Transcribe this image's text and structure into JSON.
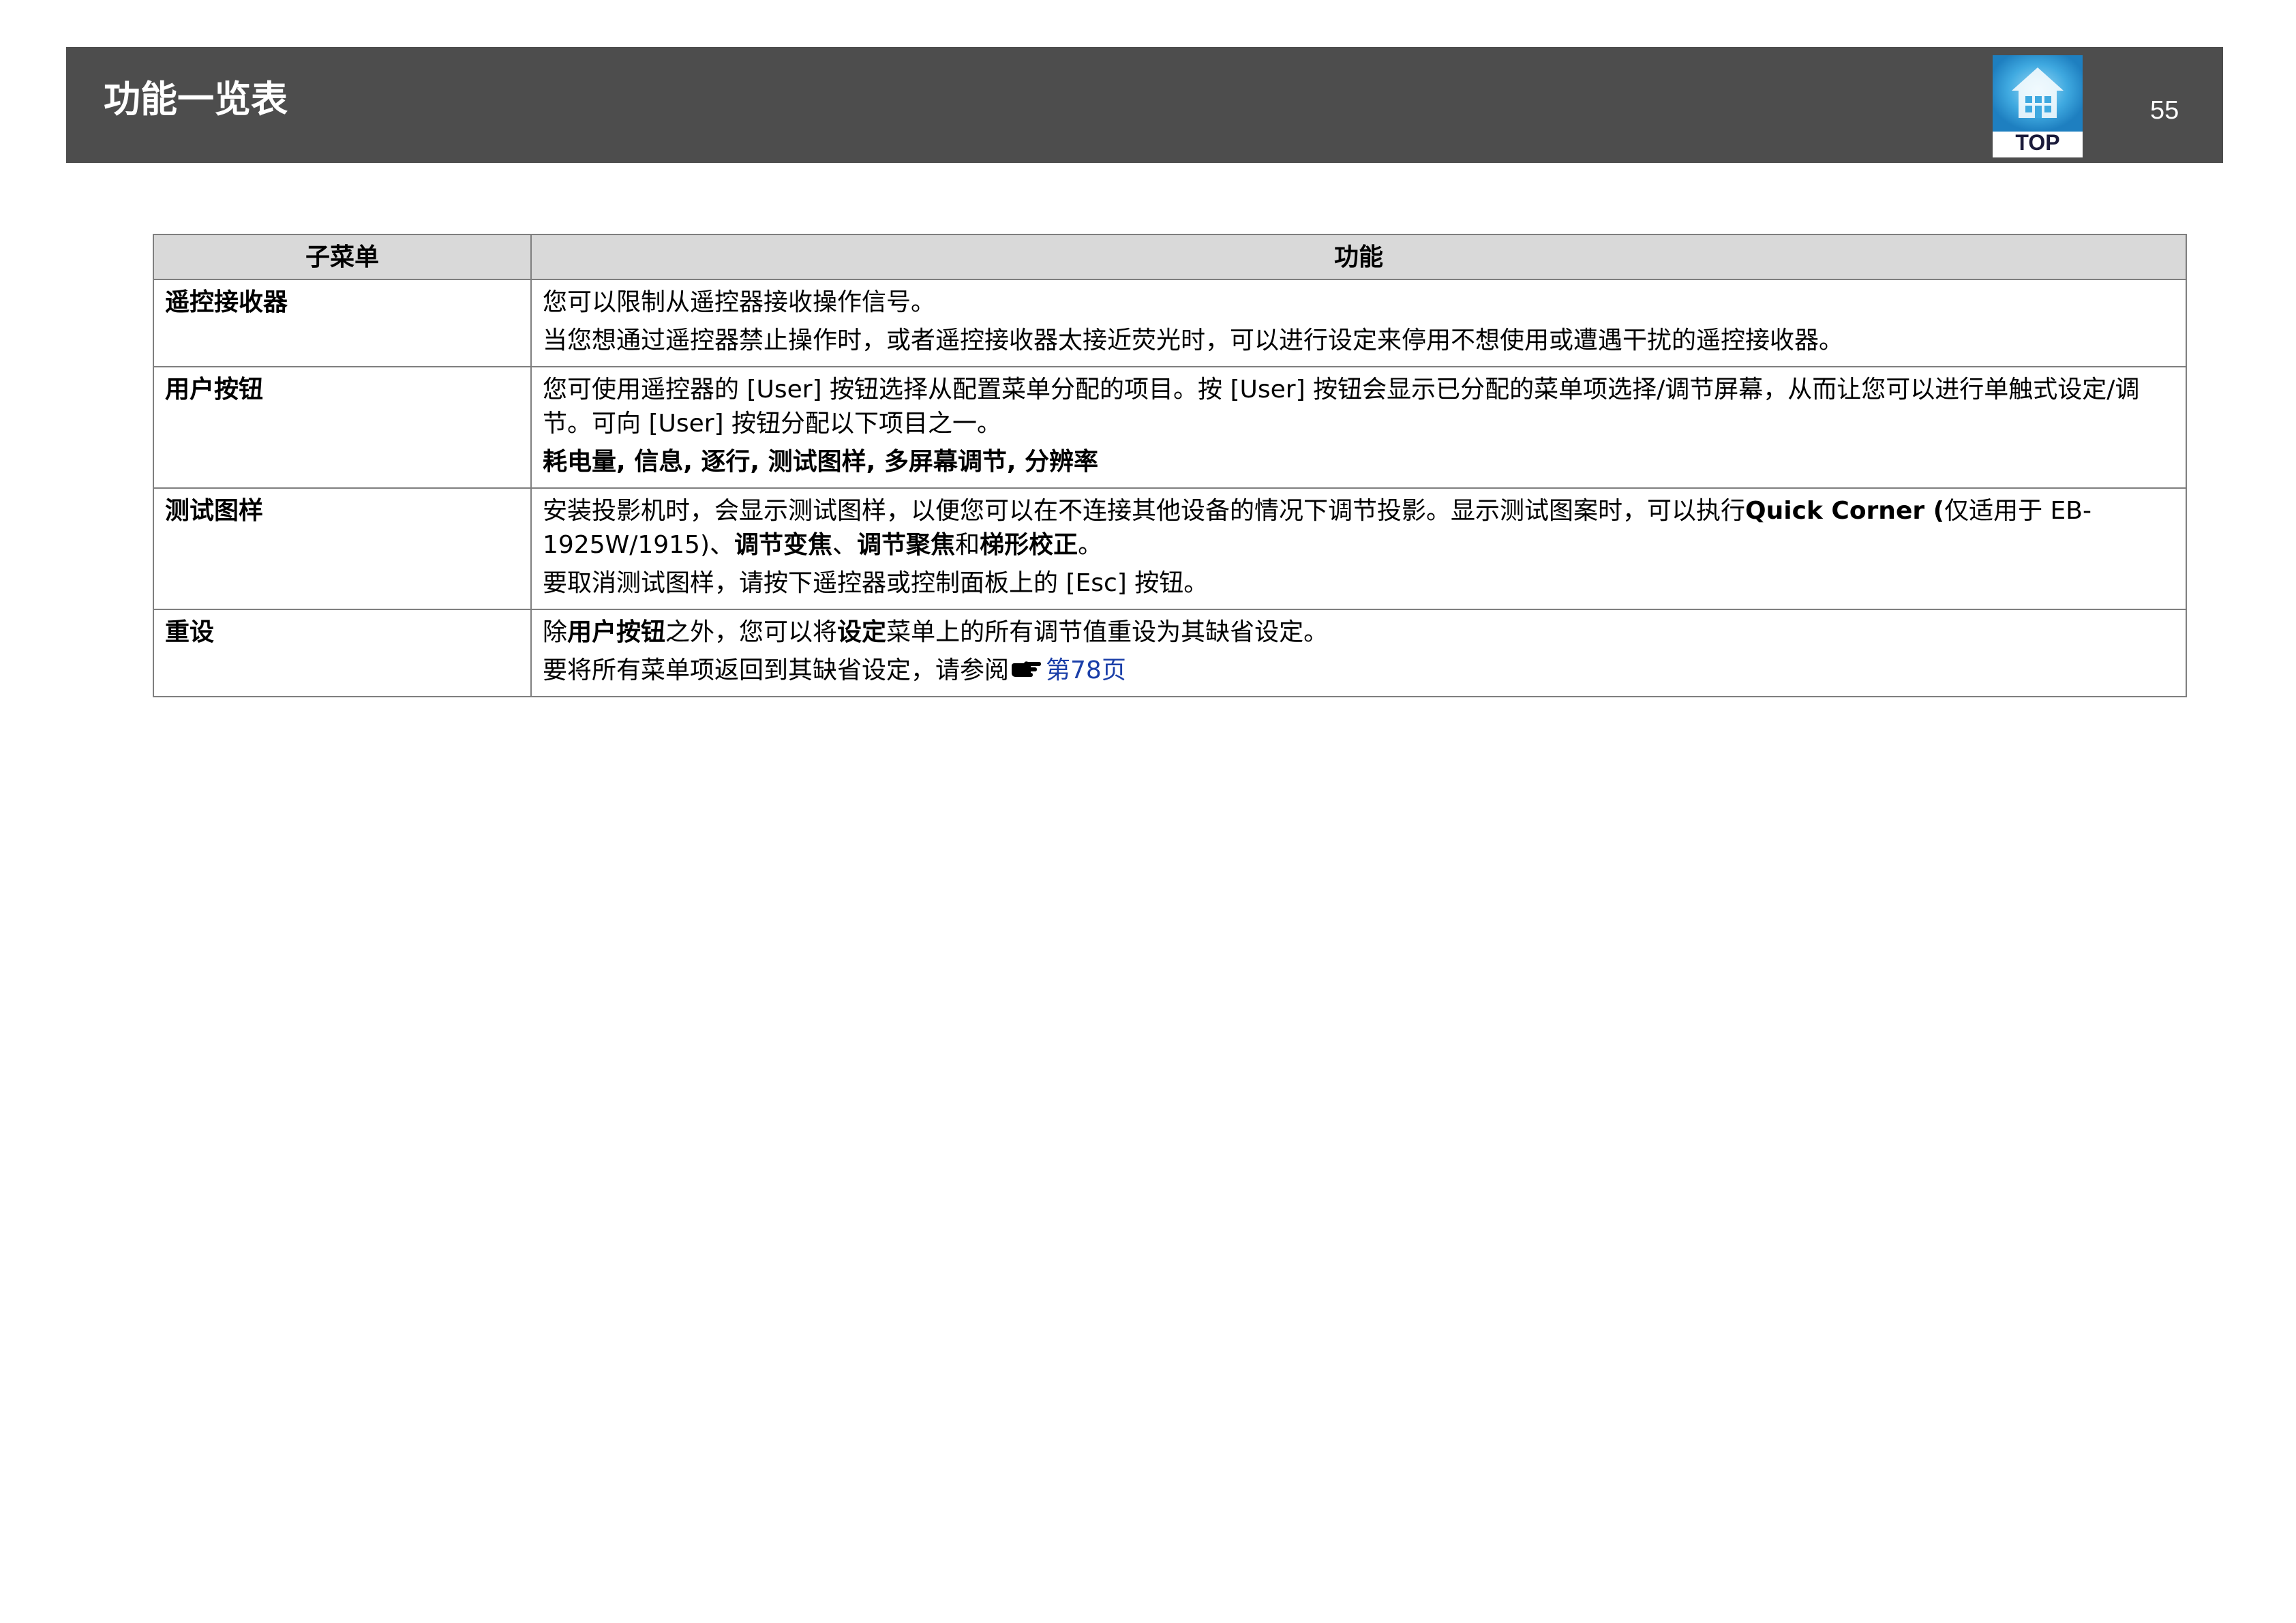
{
  "header": {
    "title": "功能一览表",
    "top_button_label": "TOP",
    "page_number": "55",
    "top_icon": "house-icon"
  },
  "table": {
    "columns": [
      "子菜单",
      "功能"
    ],
    "rows": [
      {
        "name": "遥控接收器",
        "p1": "您可以限制从遥控器接收操作信号。",
        "p2": "当您想通过遥控器禁止操作时，或者遥控接收器太接近荧光时，可以进行设定来停用不想使用或遭遇干扰的遥控接收器。"
      },
      {
        "name": "用户按钮",
        "p1": "您可使用遥控器的 [User] 按钮选择从配置菜单分配的项目。按 [User] 按钮会显示已分配的菜单项选择/调节屏幕，从而让您可以进行单触式设定/调节。可向 [User] 按钮分配以下项目之一。",
        "p2": "耗电量, 信息, 逐行, 测试图样, 多屏幕调节, 分辨率"
      },
      {
        "name": "测试图样",
        "p1_a": "安装投影机时，会显示测试图样，以便您可以在不连接其他设备的情况下调节投影。显示测试图案时，可以执行",
        "p1_b": "Quick Corner (",
        "p1_c": "仅适用于 EB-1925W/1915)、",
        "p1_d": "调节变焦",
        "p1_e": "、",
        "p1_f": "调节聚焦",
        "p1_g": "和",
        "p1_h": "梯形校正",
        "p1_i": "。",
        "p2": "要取消测试图样，请按下遥控器或控制面板上的 [Esc] 按钮。"
      },
      {
        "name": "重设",
        "p1_a": "除",
        "p1_b": "用户按钮",
        "p1_c": "之外，您可以将",
        "p1_d": "设定",
        "p1_e": "菜单上的所有调节值重设为其缺省设定。",
        "p2_text": "要将所有菜单项返回到其缺省设定，请参阅",
        "p2_icon": "pointing-hand-icon",
        "p2_link": "第78页"
      }
    ]
  },
  "colors": {
    "header_bg": "#4d4d4d",
    "table_header_bg": "#d9d9d9",
    "border": "#7f7f7f",
    "link": "#1a3ea8",
    "top_icon_blue": "#3fa9e0"
  }
}
